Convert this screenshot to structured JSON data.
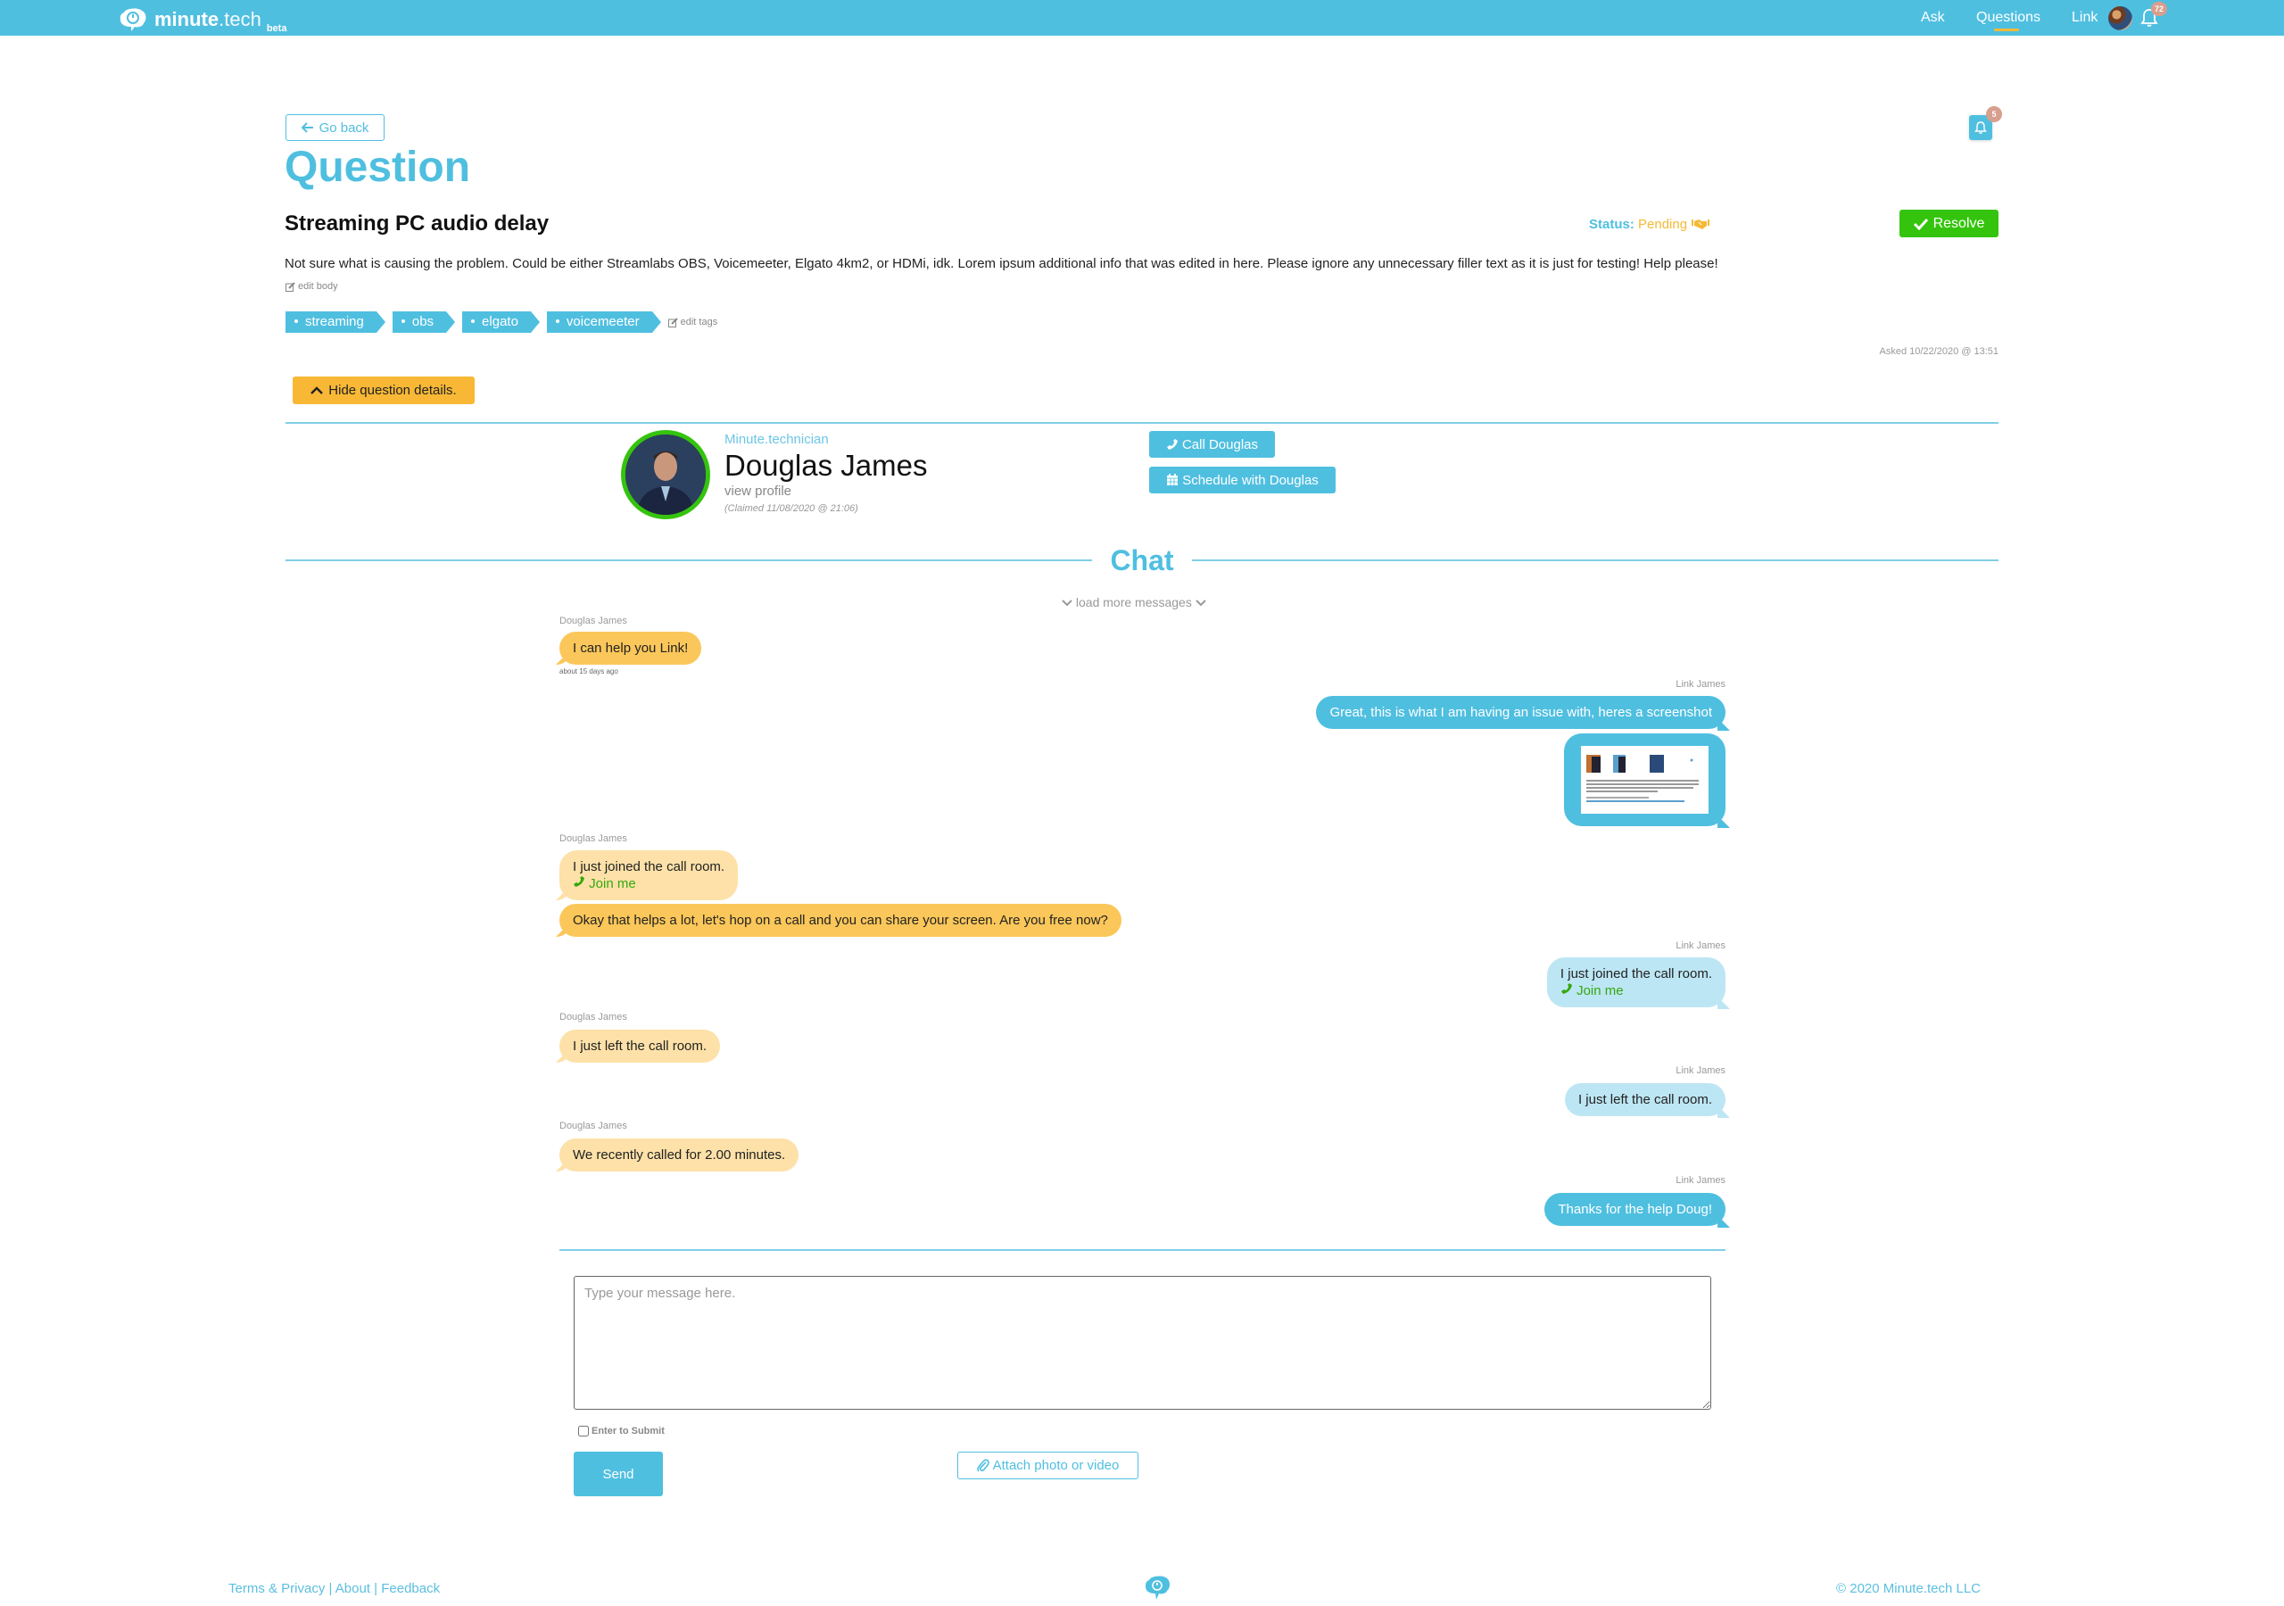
{
  "nav": {
    "logo_bold": "minute",
    "logo_light": ".tech",
    "logo_tag": "beta",
    "items": [
      {
        "label": "Ask"
      },
      {
        "label": "Questions",
        "active": true
      },
      {
        "label": "Link"
      }
    ],
    "notification_count": "72"
  },
  "page": {
    "go_back": "Go back",
    "title": "Question",
    "bell_badge": "5"
  },
  "question": {
    "title": "Streaming PC audio delay",
    "status_label": "Status:",
    "status_value": "Pending",
    "resolve_label": "Resolve",
    "body": "Not sure what is causing the problem. Could be either Streamlabs OBS, Voicemeeter, Elgato 4km2, or HDMi, idk. Lorem ipsum additional info that was edited in here. Please ignore any unnecessary filler text as it is just for testing! Help please!",
    "edit_body": "edit body",
    "tags": [
      "streaming",
      "obs",
      "elgato",
      "voicemeeter"
    ],
    "edit_tags": "edit tags",
    "asked": "Asked 10/22/2020 @ 13:51",
    "hide_details": "Hide question details."
  },
  "technician": {
    "role": "Minute.technician",
    "name": "Douglas James",
    "view_profile": "view profile",
    "claimed": "(Claimed 11/08/2020 @ 21:06)",
    "call_label": "Call Douglas",
    "schedule_label": "Schedule with Douglas"
  },
  "chat": {
    "heading": "Chat",
    "load_more": "load more messages",
    "messages": [
      {
        "sender": "Douglas James",
        "side": "left",
        "text": "I can help you Link!",
        "timestamp": "about 15 days ago"
      },
      {
        "sender": "Link James",
        "side": "right",
        "text": "Great, this is what I am having an issue with, heres a screenshot"
      },
      {
        "sender": "Link James",
        "side": "right",
        "type": "image",
        "alt": "screenshot attachment"
      },
      {
        "sender": "Douglas James",
        "side": "left",
        "text": "I just joined the call room.",
        "action": "Join me"
      },
      {
        "sender": "Douglas James",
        "side": "left",
        "text": "Okay that helps a lot, let's hop on a call and you can share your screen. Are you free now?"
      },
      {
        "sender": "Link James",
        "side": "right",
        "text": "I just joined the call room.",
        "action": "Join me"
      },
      {
        "sender": "Douglas James",
        "side": "left",
        "text": "I just left the call room."
      },
      {
        "sender": "Link James",
        "side": "right",
        "text": "I just left the call room."
      },
      {
        "sender": "Douglas James",
        "side": "left",
        "text": "We recently called for 2.00 minutes."
      },
      {
        "sender": "Link James",
        "side": "right",
        "text": "Thanks for the help Doug!"
      }
    ]
  },
  "composer": {
    "placeholder": "Type your message here.",
    "value": "",
    "enter_to_submit": "Enter to Submit",
    "enter_checked": false,
    "send_label": "Send",
    "attach_label": "Attach photo or video"
  },
  "footer": {
    "terms": "Terms & Privacy",
    "about": "About",
    "feedback": "Feedback",
    "sep": "|",
    "copyright": "© 2020 Minute.tech LLC"
  },
  "colors": {
    "brand": "#4fbfe0",
    "accent_yellow": "#f8b835",
    "success": "#35c40d",
    "badge": "#d89e8e"
  }
}
